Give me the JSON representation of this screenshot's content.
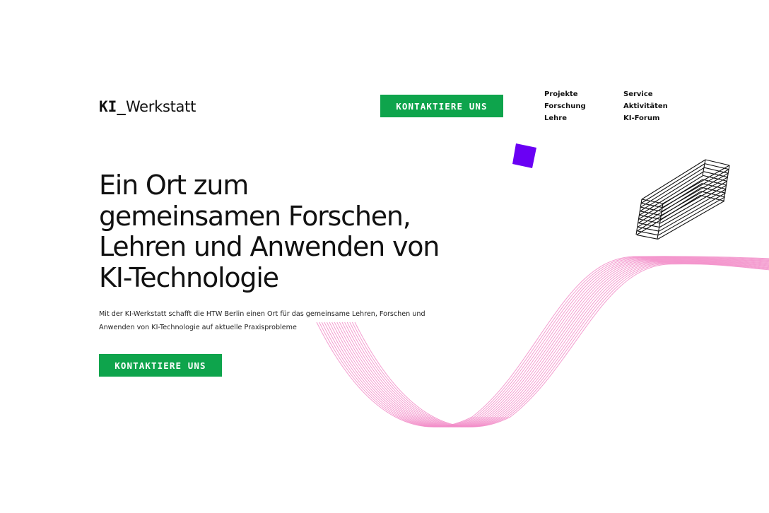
{
  "brand": {
    "logo_mark": "KI_",
    "logo_text": "Werkstatt"
  },
  "header": {
    "cta_label": "KONTAKTIERE UNS"
  },
  "nav": {
    "column_1": [
      "Projekte",
      "Forschung",
      "Lehre"
    ],
    "column_2": [
      "Service",
      "Aktivitäten",
      "KI-Forum"
    ]
  },
  "hero": {
    "headline_lines": [
      "Ein Ort zum",
      "gemeinsamen Forschen,",
      "Lehren und Anwenden von",
      "KI-Technologie"
    ],
    "intro_lines": [
      "Mit der KI-Werkstatt schafft die HTW Berlin einen Ort für das gemeinsame Lehren, Forschen und",
      "Anwenden von KI-Technologie auf aktuelle Praxisprobleme"
    ],
    "cta_label": "KONTAKTIERE UNS"
  },
  "colors": {
    "accent_green": "#0ea44c",
    "accent_purple": "#6a00f4",
    "wave_pink": "#f28cc8",
    "text": "#111111",
    "background": "#ffffff"
  },
  "icons": {
    "purple_square": "purple-square-shape",
    "wireframe_box": "wireframe-box-shape",
    "wave": "pink-wave-lines"
  }
}
